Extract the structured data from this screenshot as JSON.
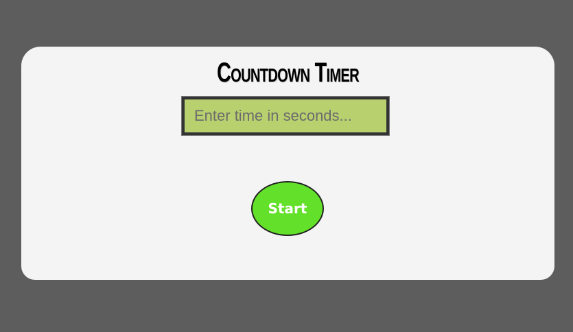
{
  "timer": {
    "title": "Countdown Timer",
    "input_placeholder": "Enter time in seconds...",
    "input_value": "",
    "start_label": "Start"
  },
  "colors": {
    "background": "#5e5d5e",
    "card": "#f4f4f4",
    "input_background": "#b8d06e",
    "start_button": "#63e02a"
  }
}
